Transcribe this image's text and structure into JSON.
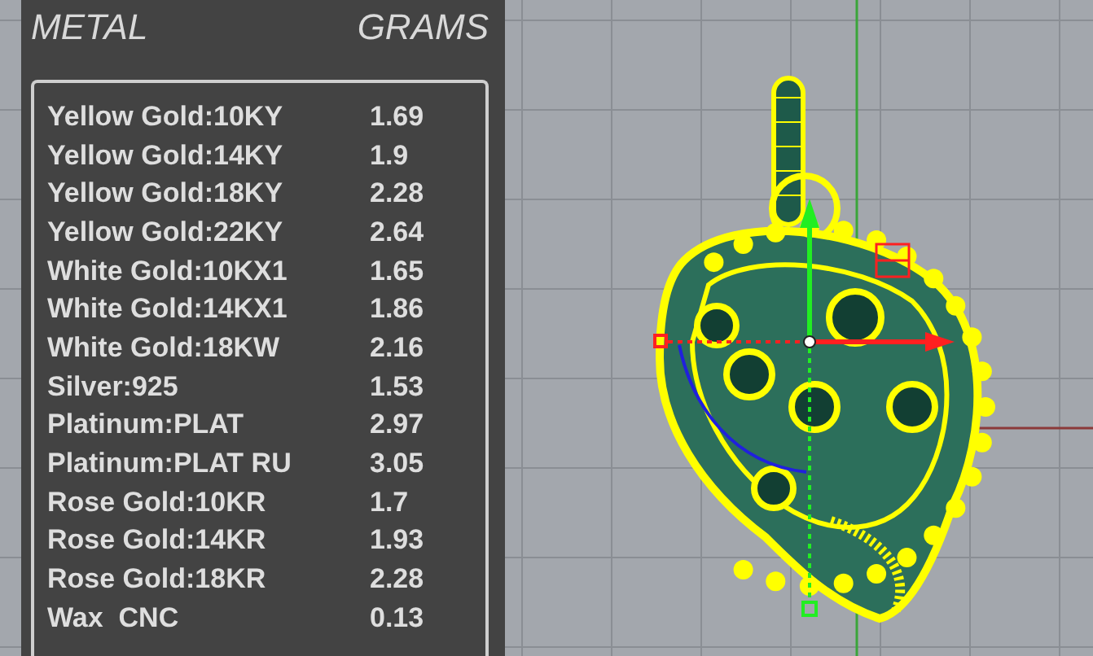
{
  "panel": {
    "header": {
      "metal": "METAL",
      "grams": "GRAMS"
    },
    "rows": [
      {
        "metal": "Yellow Gold:10KY",
        "grams": "1.69"
      },
      {
        "metal": "Yellow Gold:14KY",
        "grams": "1.9"
      },
      {
        "metal": "Yellow Gold:18KY",
        "grams": "2.28"
      },
      {
        "metal": "Yellow Gold:22KY",
        "grams": "2.64"
      },
      {
        "metal": "White Gold:10KX1",
        "grams": "1.65"
      },
      {
        "metal": "White Gold:14KX1",
        "grams": "1.86"
      },
      {
        "metal": "White Gold:18KW",
        "grams": "2.16"
      },
      {
        "metal": "Silver:925",
        "grams": "1.53"
      },
      {
        "metal": "Platinum:PLAT",
        "grams": "2.97"
      },
      {
        "metal": "Platinum:PLAT RU",
        "grams": "3.05"
      },
      {
        "metal": "Rose Gold:10KR",
        "grams": "1.7"
      },
      {
        "metal": "Rose Gold:14KR",
        "grams": "1.93"
      },
      {
        "metal": "Rose Gold:18KR",
        "grams": "2.28"
      },
      {
        "metal": "Wax  CNC",
        "grams": "0.13"
      }
    ]
  }
}
